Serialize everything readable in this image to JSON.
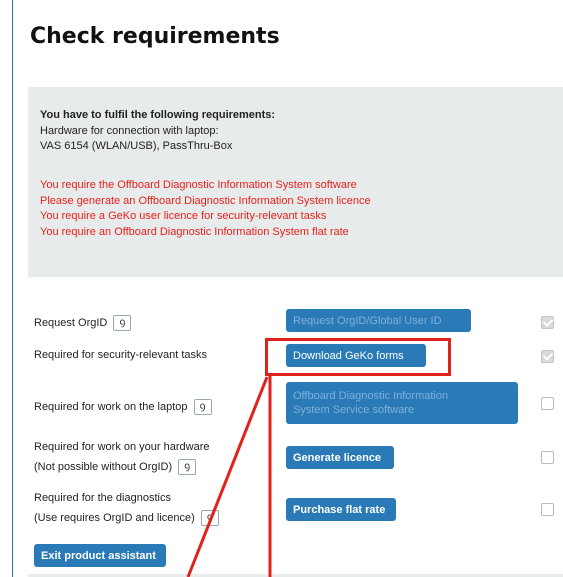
{
  "title": "Check requirements",
  "requirements": {
    "heading": "You have to fulfil the following requirements:",
    "hardware_label": "Hardware for connection with laptop:",
    "hardware_value": "VAS 6154 (WLAN/USB), PassThru-Box",
    "warnings": [
      "You require the Offboard Diagnostic Information System software",
      "Please generate an Offboard Diagnostic Information System licence",
      "You require a GeKo user licence for security-relevant tasks",
      "You require an Offboard Diagnostic Information System flat rate"
    ]
  },
  "rows": [
    {
      "label_lines": [
        "Request OrgID"
      ],
      "button": "Request OrgID/Global User ID",
      "enabled": false,
      "checked": true
    },
    {
      "label_lines": [
        "Required for security-relevant tasks"
      ],
      "button": "Download GeKo forms",
      "enabled": true,
      "checked": true
    },
    {
      "label_lines": [
        "Required for work on the laptop"
      ],
      "button_lines": [
        "Offboard Diagnostic Information",
        "System Service software"
      ],
      "enabled": false,
      "checked": false
    },
    {
      "label_lines": [
        "Required for work on your hardware",
        "(Not possible without OrgID)"
      ],
      "button": "Generate licence",
      "enabled": true,
      "checked": false
    },
    {
      "label_lines": [
        "Required for the diagnostics",
        "(Use requires OrgID and licence)"
      ],
      "button": "Purchase flat rate",
      "enabled": true,
      "checked": false
    }
  ],
  "exit_button": "Exit product assistant",
  "info_icon_glyph": "ꝯ",
  "annotation_color": "#e0221c",
  "button_color": "#2a7ab8"
}
